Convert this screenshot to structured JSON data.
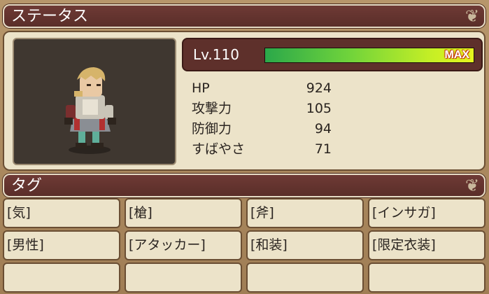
{
  "status_section": {
    "title": "ステータス"
  },
  "level": {
    "label": "Lv.110",
    "max_label": "MAX",
    "progress": 1.0
  },
  "stats": [
    {
      "name": "HP",
      "value": "924"
    },
    {
      "name": "攻撃力",
      "value": "105"
    },
    {
      "name": "防御力",
      "value": "94"
    },
    {
      "name": "すばやさ",
      "value": "71"
    }
  ],
  "tags_section": {
    "title": "タグ"
  },
  "tags": [
    "[気]",
    "[槍]",
    "[斧]",
    "[インサガ]",
    "[男性]",
    "[アタッカー]",
    "[和装]",
    "[限定衣装]",
    "",
    "",
    "",
    ""
  ],
  "colors": {
    "header_bg": "#5e302b",
    "panel_bg": "#ece3c9",
    "border": "#6a4e33",
    "max_outline": "#c43a10"
  }
}
